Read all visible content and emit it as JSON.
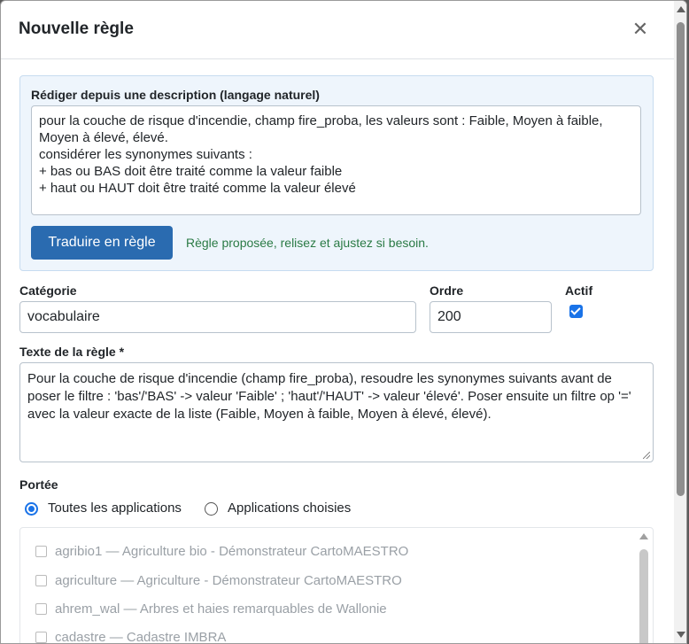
{
  "dialog": {
    "title": "Nouvelle règle",
    "close_icon": "close-icon",
    "close_glyph": "✕"
  },
  "nl": {
    "label": "Rédiger depuis une description (langage naturel)",
    "text": "pour la couche de risque d'incendie, champ fire_proba, les valeurs sont : Faible, Moyen à faible, Moyen à élevé, élevé.\nconsidérer les synonymes suivants :\n+ bas ou BAS doit être traité comme la valeur faible\n+ haut ou HAUT doit être traité comme la valeur élevé",
    "translate_label": "Traduire en règle",
    "status": "Règle proposée, relisez et ajustez si besoin."
  },
  "fields": {
    "category_label": "Catégorie",
    "category_value": "vocabulaire",
    "order_label": "Ordre",
    "order_value": "200",
    "active_label": "Actif",
    "active_checked": true,
    "rule_label": "Texte de la règle *",
    "rule_text": "Pour la couche de risque d'incendie (champ fire_proba), resoudre les synonymes suivants avant de poser le filtre : 'bas'/'BAS' -> valeur 'Faible' ; 'haut'/'HAUT' -> valeur 'élevé'. Poser ensuite un filtre op '=' avec la valeur exacte de la liste (Faible, Moyen à faible, Moyen à élevé, élevé)."
  },
  "scope": {
    "label": "Portée",
    "option_all": "Toutes les applications",
    "option_selected": "Applications choisies",
    "selected": "all",
    "apps": [
      "agribio1 — Agriculture bio - Démonstrateur CartoMAESTRO",
      "agriculture — Agriculture - Démonstrateur CartoMAESTRO",
      "ahrem_wal — Arbres et haies remarquables de Wallonie",
      "cadastre — Cadastre IMBRA"
    ]
  },
  "colors": {
    "primary": "#2a6bb0",
    "success_text": "#2a7a45",
    "nl_box_bg": "#eef5fc",
    "checkbox": "#1a73e8"
  }
}
